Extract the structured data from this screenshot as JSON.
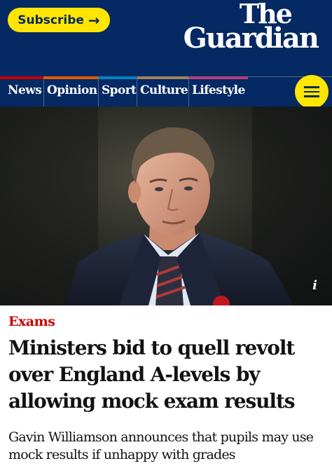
{
  "header": {
    "subscribe_label": "Subscribe",
    "logo": {
      "line1": "The",
      "line2": "Guardian"
    },
    "background": "#052962",
    "accent_yellow": "#ffe500"
  },
  "nav": {
    "items": [
      {
        "label": "News",
        "color": "#c70000"
      },
      {
        "label": "Opinion",
        "color": "#e05e00"
      },
      {
        "label": "Sport",
        "color": "#0084c6"
      },
      {
        "label": "Culture",
        "color": "#a1845c"
      },
      {
        "label": "Lifestyle",
        "color": "#bb3b80"
      }
    ],
    "menu_icon": "hamburger-icon"
  },
  "photo": {
    "info_label": "i",
    "info_icon": "info-icon"
  },
  "article": {
    "kicker": "Exams",
    "kicker_color": "#c70000",
    "headline": "Ministers bid to quell revolt over England A-levels by allowing mock exam results",
    "standfirst": "Gavin Williamson announces that pupils may use mock results if unhappy with grades"
  }
}
